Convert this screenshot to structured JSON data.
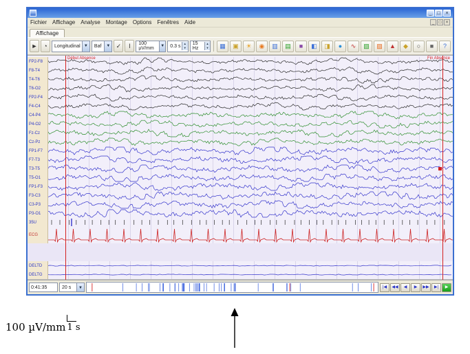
{
  "figure": {
    "scale_label": "100 µV/mm",
    "time_label": "1 s"
  },
  "window": {
    "controls": {
      "minimize": "_",
      "maximize": "□",
      "close": "×"
    },
    "menu": {
      "items": [
        {
          "label": "Fichier"
        },
        {
          "label": "Affichage"
        },
        {
          "label": "Analyse"
        },
        {
          "label": "Montage"
        },
        {
          "label": "Options"
        },
        {
          "label": "Fenêtres"
        },
        {
          "label": "Aide"
        }
      ]
    },
    "tab": {
      "label": "Affichage"
    },
    "toolbar": {
      "pointer_button": "►",
      "clock_button": "◔",
      "montage_select": "Longitudinal",
      "filter_select": "Baf",
      "check_button": "✓",
      "slider_button": "Ι",
      "sensitivity": "100 µV/mm",
      "timebase": "0.3 s",
      "highcut": "15 Hz",
      "icons": [
        {
          "name": "grid-display-icon",
          "glyph": "▦",
          "color": "#3a6fd8"
        },
        {
          "name": "screen-layout-icon",
          "glyph": "▣",
          "color": "#caa22a"
        },
        {
          "name": "sun-icon",
          "glyph": "☀",
          "color": "#e8a020"
        },
        {
          "name": "lamp-icon",
          "glyph": "◉",
          "color": "#e87a20"
        },
        {
          "name": "columns-icon",
          "glyph": "▥",
          "color": "#3a6fd8"
        },
        {
          "name": "histogram-icon",
          "glyph": "▤",
          "color": "#28a028"
        },
        {
          "name": "video-icon",
          "glyph": "■",
          "color": "#8a4aa8"
        },
        {
          "name": "camera-icon",
          "glyph": "◧",
          "color": "#3a6fd8"
        },
        {
          "name": "save-disk-icon",
          "glyph": "◨",
          "color": "#caa22a"
        },
        {
          "name": "globe-icon",
          "glyph": "●",
          "color": "#2a8fd8"
        },
        {
          "name": "wave-tool-icon",
          "glyph": "∿",
          "color": "#c03030"
        },
        {
          "name": "map-icon",
          "glyph": "▧",
          "color": "#28a028"
        },
        {
          "name": "brain-map-icon",
          "glyph": "▨",
          "color": "#e86a20"
        },
        {
          "name": "spike-marker-icon",
          "glyph": "▲",
          "color": "#c03030"
        },
        {
          "name": "flag-icon",
          "glyph": "◆",
          "color": "#caa22a"
        },
        {
          "name": "search-icon",
          "glyph": "○",
          "color": "#444444"
        },
        {
          "name": "print-icon",
          "glyph": "■",
          "color": "#666666"
        },
        {
          "name": "help-icon",
          "glyph": "?",
          "color": "#3a6fd8"
        }
      ]
    },
    "annotations": {
      "start_marker": "Début Absence",
      "end_marker": "Fin Absence"
    },
    "channels": [
      {
        "label": "FP2-F8",
        "color": "#2a2a2a",
        "type": "eeg"
      },
      {
        "label": "F8-T4",
        "color": "#2a2a2a",
        "type": "eeg"
      },
      {
        "label": "T4-T6",
        "color": "#2a2a2a",
        "type": "eeg"
      },
      {
        "label": "T6-O2",
        "color": "#2a2a2a",
        "type": "eeg"
      },
      {
        "label": "FP2-F4",
        "color": "#2a2a2a",
        "type": "eeg"
      },
      {
        "label": "F4-C4",
        "color": "#2a2a2a",
        "type": "eeg"
      },
      {
        "label": "C4-P4",
        "color": "#2f8f2f",
        "type": "eeg"
      },
      {
        "label": "P4-O2",
        "color": "#2f8f2f",
        "type": "eeg"
      },
      {
        "label": "Fz-Cz",
        "color": "#2f8f2f",
        "type": "eeg"
      },
      {
        "label": "Cz-Pz",
        "color": "#2f8f2f",
        "type": "eeg"
      },
      {
        "label": "FP1-F7",
        "color": "#3535cc",
        "type": "eeg"
      },
      {
        "label": "F7-T3",
        "color": "#3535cc",
        "type": "eeg"
      },
      {
        "label": "T3-T5",
        "color": "#3535cc",
        "type": "eeg"
      },
      {
        "label": "T5-O1",
        "color": "#3535cc",
        "type": "eeg"
      },
      {
        "label": "FP1-F3",
        "color": "#3535cc",
        "type": "eeg"
      },
      {
        "label": "F3-C3",
        "color": "#3535cc",
        "type": "eeg"
      },
      {
        "label": "C3-P3",
        "color": "#3535cc",
        "type": "eeg"
      },
      {
        "label": "P3-O1",
        "color": "#3535cc",
        "type": "eeg"
      },
      {
        "label": "35U",
        "color": "#2a2a2a",
        "type": "marker"
      },
      {
        "label": "ECG",
        "color": "#cc2222",
        "type": "ecg"
      },
      {
        "label": "DELTD",
        "color": "#3535cc",
        "type": "emg"
      },
      {
        "label": "DELTG",
        "color": "#3535cc",
        "type": "emg"
      }
    ],
    "statusbar": {
      "time": "0:41:35",
      "page_scale": "20 s"
    },
    "nav": {
      "buttons": [
        {
          "name": "page-first-button",
          "glyph": "|◀"
        },
        {
          "name": "page-fast-back-button",
          "glyph": "◀◀"
        },
        {
          "name": "page-back-button",
          "glyph": "◀"
        },
        {
          "name": "page-forward-button",
          "glyph": "▶"
        },
        {
          "name": "page-fast-forward-button",
          "glyph": "▶▶"
        },
        {
          "name": "page-last-button",
          "glyph": "▶|"
        },
        {
          "name": "play-button",
          "glyph": "▶",
          "green": true
        }
      ]
    }
  }
}
